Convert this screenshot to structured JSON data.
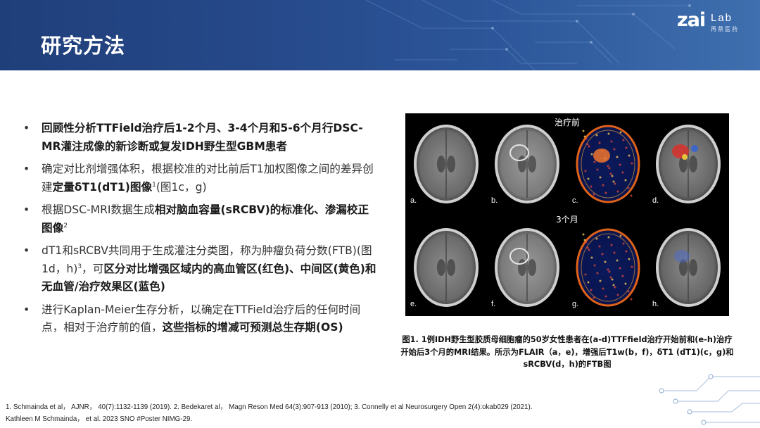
{
  "header": {
    "title": "研究方法",
    "logo_main": "zai",
    "logo_sub": "Lab",
    "logo_cn": "再鼎医药",
    "colors": {
      "header_start": "#1f3f7a",
      "header_end": "#3f6fae"
    }
  },
  "bullets": [
    {
      "parts": [
        {
          "t": "回顾性分析TTField治疗后1-2个月、3-4个月和5-6个月行DSC-MR灌注成像的新诊断或复发IDH野生型GBM患者",
          "b": true
        }
      ]
    },
    {
      "parts": [
        {
          "t": "确定对比剂增强体积，根据校准的对比前后T1加权图像之间的差异创建",
          "b": false
        },
        {
          "t": "定量δT1(dT1)图像",
          "b": true
        },
        {
          "t": "1",
          "sup": true
        },
        {
          "t": "(图1c，g)",
          "b": false
        }
      ]
    },
    {
      "parts": [
        {
          "t": "根据DSC-MRI数据生成",
          "b": false
        },
        {
          "t": "相对脑血容量(sRCBV)的标准化、渗漏校正图像",
          "b": true
        },
        {
          "t": "2",
          "sup": true
        }
      ]
    },
    {
      "parts": [
        {
          "t": "dT1和sRCBV共同用于生成灌注分类图，称为肿瘤负荷分数(FTB)(图1d，h)",
          "b": false
        },
        {
          "t": "3",
          "sup": true
        },
        {
          "t": "，可",
          "b": false
        },
        {
          "t": "区分对比增强区域内的高血管区(红色)、中间区(黄色)和无血管/治疗效果区(蓝色)",
          "b": true
        }
      ]
    },
    {
      "parts": [
        {
          "t": "进行Kaplan-Meier生存分析，以确定在TTField治疗后的任何时间点，相对于治疗前的值，",
          "b": false
        },
        {
          "t": "这些指标的增减可预测总生存期(OS)",
          "b": true
        }
      ]
    }
  ],
  "figure": {
    "label_top": "治疗前",
    "label_mid": "3个月",
    "panels": [
      {
        "letter": "a.",
        "kind": "flair"
      },
      {
        "letter": "b.",
        "kind": "t1"
      },
      {
        "letter": "c.",
        "kind": "dt1"
      },
      {
        "letter": "d.",
        "kind": "ftb"
      },
      {
        "letter": "e.",
        "kind": "flair"
      },
      {
        "letter": "f.",
        "kind": "t1"
      },
      {
        "letter": "g.",
        "kind": "dt1"
      },
      {
        "letter": "h.",
        "kind": "ftb"
      }
    ],
    "caption": "图1. 1例IDH野生型胶质母细胞瘤的50岁女性患者在(a-d)TTFfield治疗开始前和(e-h)治疗开始后3个月的MRI结果。所示为FLAIR（a，e)，增强后T1w(b，f)，δT1 (dT1)(c，g)和sRCBV(d，h)的FTB图"
  },
  "references": {
    "line1": "1. Schmainda et al， AJNR， 40(7):1132-1139 (2019). 2. Bedekaret al， Magn Reson Med 64(3):907-913 (2010); 3. Connelly et al Neurosurgery Open 2(4):okab029 (2021).",
    "line2": "Kathleen M Schmainda， et al. 2023 SNO #Poster NIMG-29."
  }
}
